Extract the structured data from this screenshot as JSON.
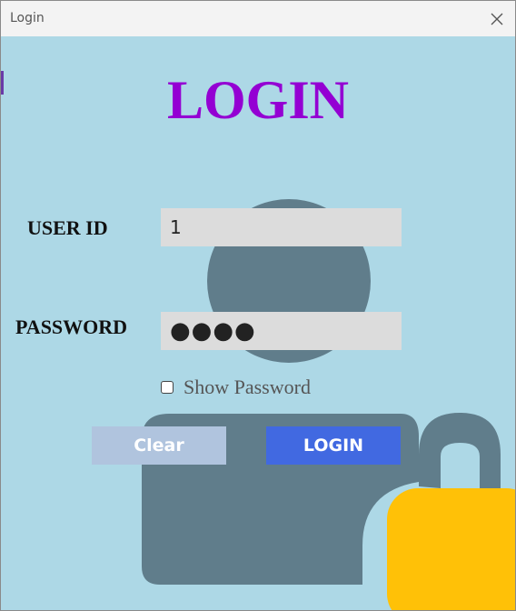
{
  "window": {
    "title": "Login"
  },
  "heading": "LOGIN",
  "form": {
    "userid_label": "USER ID",
    "userid_value": "1",
    "password_label": "PASSWORD",
    "password_value": "●●●●",
    "show_password_label": "Show Password",
    "show_password_checked": false
  },
  "buttons": {
    "clear_label": "Clear",
    "login_label": "LOGIN"
  },
  "colors": {
    "background": "#add8e6",
    "heading": "#9400d3",
    "field": "#dcdcdc",
    "clear_button": "#b0c4de",
    "login_button": "#4169e1",
    "user_silhouette": "#607d8b",
    "lock_body": "#ffc107"
  },
  "icons": {
    "close": "close-icon",
    "background_person": "user-silhouette-icon",
    "background_lock": "padlock-icon"
  }
}
